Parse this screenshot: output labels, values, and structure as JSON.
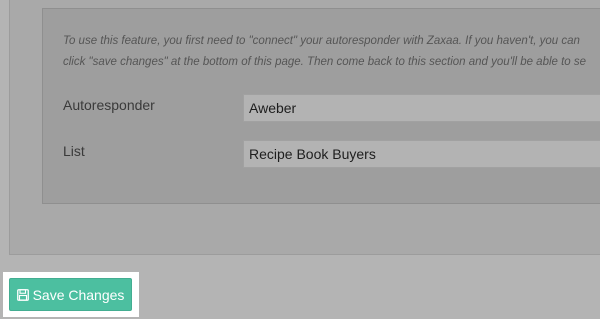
{
  "help_text": {
    "line1": "To use this feature, you first need to \"connect\" your autoresponder with Zaxaa. If you haven't, you can",
    "line2": "click \"save changes\" at the bottom of this page. Then come back to this section and you'll be able to se"
  },
  "fields": {
    "autoresponder": {
      "label": "Autoresponder",
      "value": "Aweber"
    },
    "list": {
      "label": "List",
      "value": "Recipe Book Buyers"
    }
  },
  "actions": {
    "save_label": "Save Changes",
    "save_icon": "floppy-disk-icon"
  },
  "colors": {
    "accent": "#4cbfa0",
    "overlay_background": "#b4b4b4"
  }
}
